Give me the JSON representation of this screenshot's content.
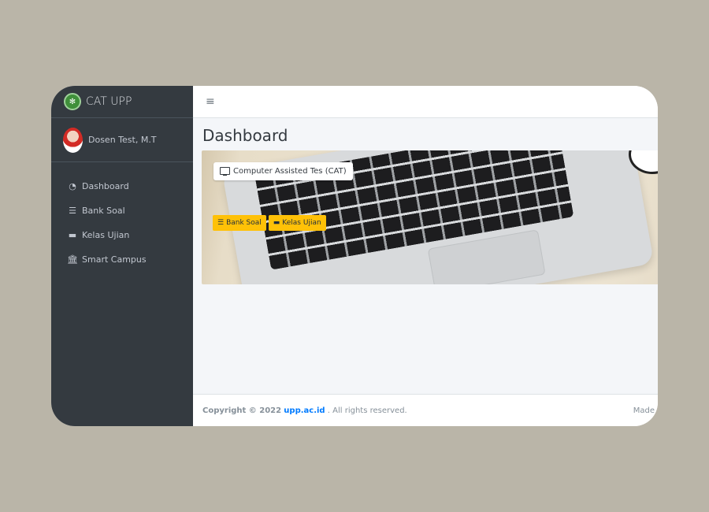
{
  "brand": {
    "title": "CAT UPP",
    "logo": "university-logo"
  },
  "user": {
    "name": "Dosen Test, M.T"
  },
  "sidebar": {
    "items": [
      {
        "icon": "dashboard-gauge-icon",
        "glyph": "◔",
        "label": "Dashboard"
      },
      {
        "icon": "list-icon",
        "glyph": "☰",
        "label": "Bank Soal"
      },
      {
        "icon": "folder-icon",
        "glyph": "▬",
        "label": "Kelas Ujian"
      },
      {
        "icon": "university-icon",
        "glyph": "🏛",
        "label": "Smart Campus"
      }
    ]
  },
  "topbar": {
    "menu_glyph": "≡"
  },
  "main": {
    "title": "Dashboard",
    "hero": {
      "badge_label": "Computer Assisted Tes (CAT)",
      "buttons": [
        {
          "icon": "list-icon",
          "glyph": "☰",
          "label": "Bank Soal"
        },
        {
          "icon": "folder-icon",
          "glyph": "▬",
          "label": "Kelas Ujian"
        }
      ]
    }
  },
  "footer": {
    "copyright_prefix": "Copyright © 2022",
    "link_text": "upp.ac.id",
    "suffix": ". All rights reserved.",
    "right_text": "Made"
  },
  "colors": {
    "sidebar_bg": "#343a40",
    "warning": "#ffc107",
    "link": "#007bff",
    "background": "#bab5a8"
  }
}
